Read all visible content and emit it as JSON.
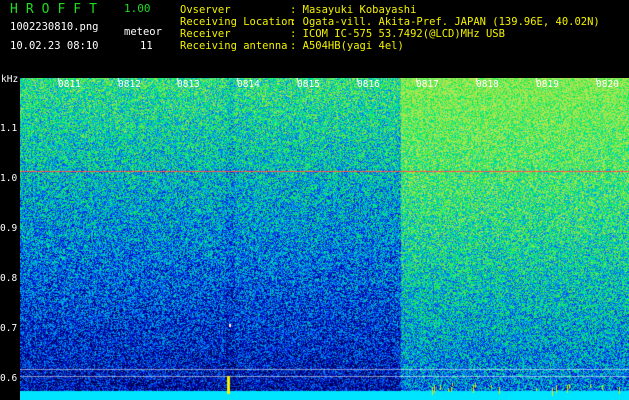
{
  "app": {
    "name": "HROFFT",
    "version": "1.00"
  },
  "file": {
    "name": "1002230810.png",
    "datetime": "10.02.23 08:10"
  },
  "meteor": {
    "label": "meteor",
    "count": "11"
  },
  "info": [
    {
      "label": "Ovserver",
      "value": ": Masayuki Kobayashi"
    },
    {
      "label": "Receiving Location",
      "value": ": Ogata-vill. Akita-Pref. JAPAN (139.96E, 40.02N)"
    },
    {
      "label": "Receiver",
      "value": ": ICOM IC-575 53.7492(@LCD)MHz USB"
    },
    {
      "label": "Receiving antenna",
      "value": ": A504HB(yagi 4el)"
    }
  ],
  "axis": {
    "y_unit": "kHz",
    "y_ticks": [
      "1.1",
      "1.0",
      "0.9",
      "0.8",
      "0.7",
      "0.6"
    ],
    "x_ticks": [
      "0811",
      "0812",
      "0813",
      "0814",
      "0815",
      "0816",
      "0817",
      "0818",
      "0819",
      "0820"
    ]
  },
  "colors": {
    "background": "#000000",
    "title_green": "#1fdc1f",
    "info_yellow": "#f2f200",
    "text_white": "#ffffff",
    "signal_line_red": "#ff5050",
    "baseline_cyan": "#00e5ff"
  }
}
